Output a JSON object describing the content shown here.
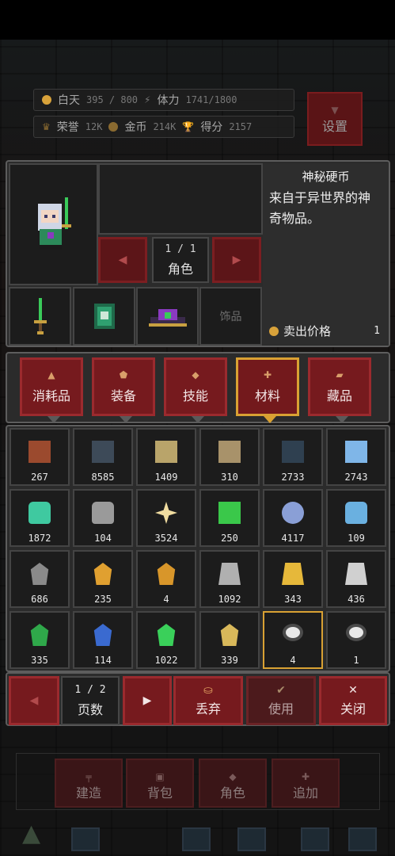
{
  "stats": {
    "day_label": "白天",
    "day_value": "395 / 800",
    "stamina_label": "体力",
    "stamina_value": "1741/1800",
    "honor_label": "荣誉",
    "honor_value": "12K",
    "gold_label": "金币",
    "gold_value": "214K",
    "score_label": "得分",
    "score_value": "2157",
    "settings_label": "设置"
  },
  "character": {
    "pager_value": "1 / 1",
    "pager_label": "角色",
    "accessory_slot_label": "饰品"
  },
  "item_detail": {
    "name": "神秘硬币",
    "description": "来自于异世界的神奇物品。",
    "sell_label": "卖出价格",
    "sell_price": "1"
  },
  "tabs": [
    {
      "label": "消耗品",
      "icon": "potion-icon"
    },
    {
      "label": "装备",
      "icon": "shield-icon"
    },
    {
      "label": "技能",
      "icon": "diamond-icon"
    },
    {
      "label": "材料",
      "icon": "cross-icon",
      "active": true
    },
    {
      "label": "藏品",
      "icon": "scroll-icon"
    }
  ],
  "items": [
    {
      "count": "267",
      "icon": "brick-icon",
      "color": "#9b4a2e"
    },
    {
      "count": "8585",
      "icon": "stone-block-icon",
      "color": "#3d4a58"
    },
    {
      "count": "1409",
      "icon": "sand-block-icon",
      "color": "#b9a46a"
    },
    {
      "count": "310",
      "icon": "marble-block-icon",
      "color": "#a8926a"
    },
    {
      "count": "2733",
      "icon": "stone-wall-icon",
      "color": "#2f4050"
    },
    {
      "count": "2743",
      "icon": "glass-icon",
      "color": "#7fb6e8"
    },
    {
      "count": "1872",
      "icon": "green-potion-icon",
      "color": "#3fc9a0"
    },
    {
      "count": "104",
      "icon": "gray-box-icon",
      "color": "#9a9a9a"
    },
    {
      "count": "3524",
      "icon": "star-icon",
      "color": "#f0dca0"
    },
    {
      "count": "250",
      "icon": "green-cube-icon",
      "color": "#3ac84a"
    },
    {
      "count": "4117",
      "icon": "gear-icon",
      "color": "#8a9fd6"
    },
    {
      "count": "109",
      "icon": "spray-icon",
      "color": "#6ab0e0"
    },
    {
      "count": "686",
      "icon": "iron-ore-icon",
      "color": "#8a8a8a"
    },
    {
      "count": "235",
      "icon": "gold-ore-icon",
      "color": "#e0a030"
    },
    {
      "count": "4",
      "icon": "amber-shard-icon",
      "color": "#d8962a"
    },
    {
      "count": "1092",
      "icon": "silver-ingot-icon",
      "color": "#b0b0b0"
    },
    {
      "count": "343",
      "icon": "gold-ingot-icon",
      "color": "#e6b83a"
    },
    {
      "count": "436",
      "icon": "silver-chip-icon",
      "color": "#d0d0d0"
    },
    {
      "count": "335",
      "icon": "emerald-icon",
      "color": "#2fa84a"
    },
    {
      "count": "114",
      "icon": "sapphire-icon",
      "color": "#3a6ad0"
    },
    {
      "count": "1022",
      "icon": "green-crystal-icon",
      "color": "#3ad05a"
    },
    {
      "count": "339",
      "icon": "topaz-crystal-icon",
      "color": "#d8b85a"
    },
    {
      "count": "4",
      "icon": "mystery-coin-icon",
      "color": "#e8e8e8",
      "selected": true
    },
    {
      "count": "1",
      "icon": "skull-coin-icon",
      "color": "#e8e8e8"
    }
  ],
  "bottom": {
    "page_value": "1 / 2",
    "page_label": "页数",
    "discard_label": "丢弃",
    "use_label": "使用",
    "close_label": "关闭"
  },
  "background_nav": [
    "建造",
    "背包",
    "角色",
    "追加"
  ]
}
